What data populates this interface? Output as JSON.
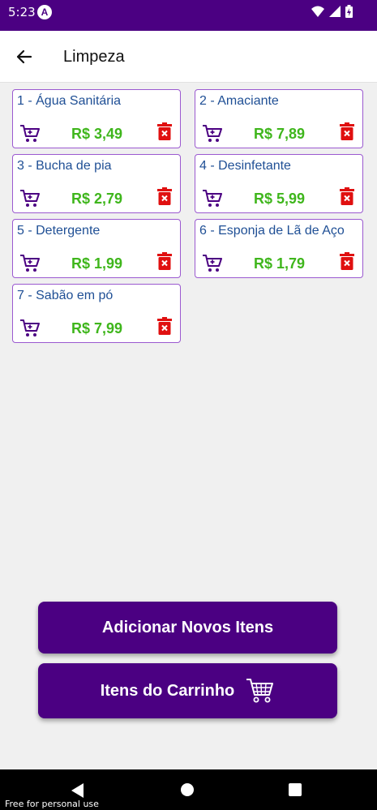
{
  "status_bar": {
    "time": "5:23",
    "app_icon_letter": "A"
  },
  "app_bar": {
    "title": "Limpeza"
  },
  "products": [
    {
      "name": "1 - Água Sanitária",
      "price": "R$ 3,49"
    },
    {
      "name": "2 - Amaciante",
      "price": "R$ 7,89"
    },
    {
      "name": "3 - Bucha de pia",
      "price": "R$ 2,79"
    },
    {
      "name": "4 - Desinfetante",
      "price": "R$ 5,99"
    },
    {
      "name": "5 - Detergente",
      "price": "R$ 1,99"
    },
    {
      "name": "6 - Esponja de Lã de Aço",
      "price": "R$ 1,79"
    },
    {
      "name": "7 - Sabão em pó",
      "price": "R$ 7,99"
    }
  ],
  "buttons": {
    "add_new": "Adicionar Novos Itens",
    "cart": "Itens do Carrinho"
  },
  "footer": {
    "watermark": "Free for personal use"
  },
  "colors": {
    "primary": "#4b0082",
    "price": "#3fb61c",
    "delete": "#e01010",
    "card_title": "#1f4f95"
  },
  "icons": {
    "back": "arrow-left-icon",
    "cart": "shopping-cart-icon",
    "delete": "trash-icon"
  }
}
